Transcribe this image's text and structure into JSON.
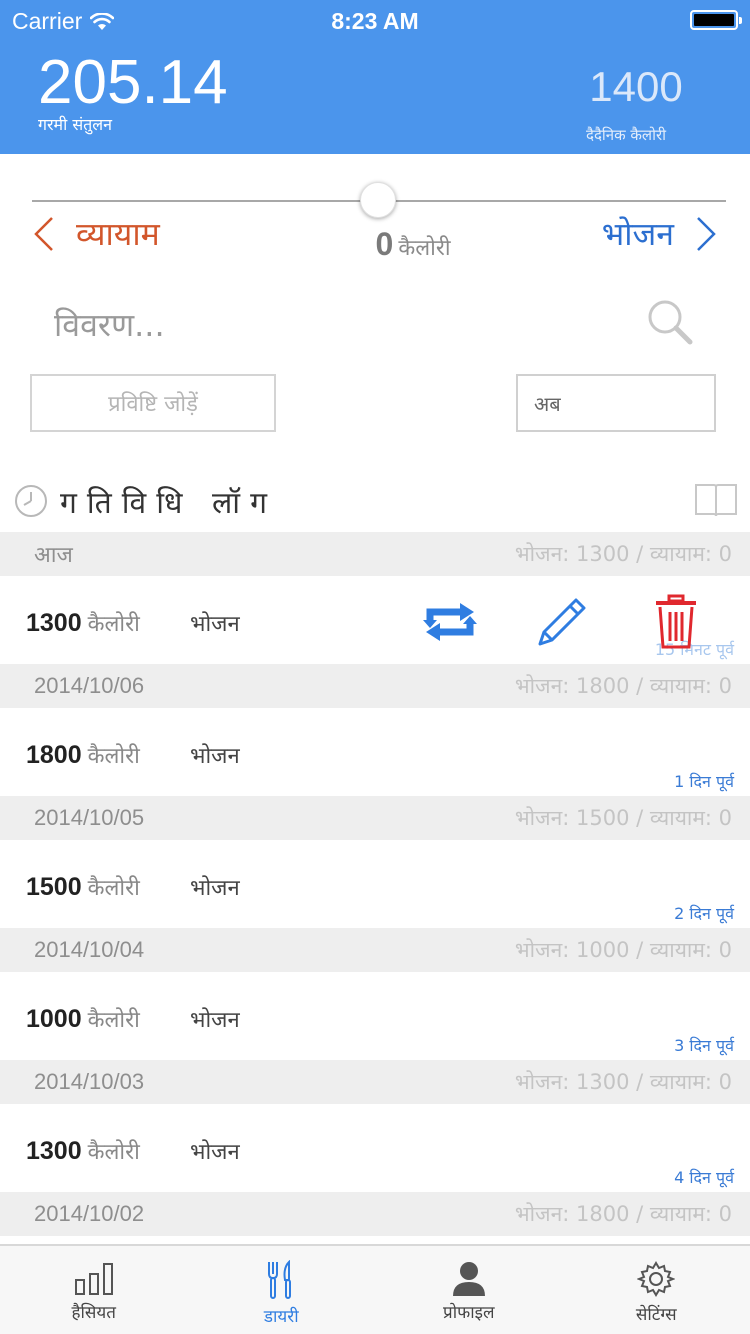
{
  "status_bar": {
    "carrier": "Carrier",
    "time": "8:23 AM"
  },
  "header": {
    "balance_value": "205.14",
    "balance_label": "गरमी संतुलन",
    "daily_value": "1400",
    "daily_label": "दैदैनिक कैलोरी",
    "background_color": "#4b95ec"
  },
  "selector": {
    "exercise_label": "व्यायाम",
    "food_label": "भोजन",
    "calories_value": "0",
    "calories_unit": "कैलोरी",
    "exercise_color": "#d2562b",
    "food_color": "#2c6fd0"
  },
  "form": {
    "description_placeholder": "विवरण...",
    "add_entry_label": "प्रविष्टि जोड़ें",
    "time_value": "अब"
  },
  "log": {
    "title": "गतिविधि लॉग",
    "entries": [
      {
        "date": "आज",
        "summary": "भोजन: 1300 / व्यायाम: 0",
        "calories": "1300",
        "unit": "कैलोरी",
        "type": "भोजन",
        "ago": "15 मिनट पूर्व"
      },
      {
        "date": "2014/10/06",
        "summary": "भोजन: 1800 / व्यायाम: 0",
        "calories": "1800",
        "unit": "कैलोरी",
        "type": "भोजन",
        "ago": "1 दिन पूर्व"
      },
      {
        "date": "2014/10/05",
        "summary": "भोजन: 1500 / व्यायाम: 0",
        "calories": "1500",
        "unit": "कैलोरी",
        "type": "भोजन",
        "ago": "2 दिन पूर्व"
      },
      {
        "date": "2014/10/04",
        "summary": "भोजन: 1000 / व्यायाम: 0",
        "calories": "1000",
        "unit": "कैलोरी",
        "type": "भोजन",
        "ago": "3 दिन पूर्व"
      },
      {
        "date": "2014/10/03",
        "summary": "भोजन: 1300 / व्यायाम: 0",
        "calories": "1300",
        "unit": "कैलोरी",
        "type": "भोजन",
        "ago": "4 दिन पूर्व"
      }
    ],
    "last_header": {
      "date": "2014/10/02",
      "summary": "भोजन: 1800 / व्यायाम: 0"
    }
  },
  "actions": {
    "repeat_icon": "repeat-icon",
    "edit_icon": "pencil-icon",
    "delete_icon": "trash-icon",
    "delete_color": "#e0282e",
    "accent_color": "#2f7de1"
  },
  "tabs": [
    {
      "label": "हैसियत",
      "icon": "bar-chart-icon"
    },
    {
      "label": "डायरी",
      "icon": "fork-knife-icon"
    },
    {
      "label": "प्रोफाइल",
      "icon": "person-icon"
    },
    {
      "label": "सेटिंग्स",
      "icon": "gear-icon"
    }
  ]
}
